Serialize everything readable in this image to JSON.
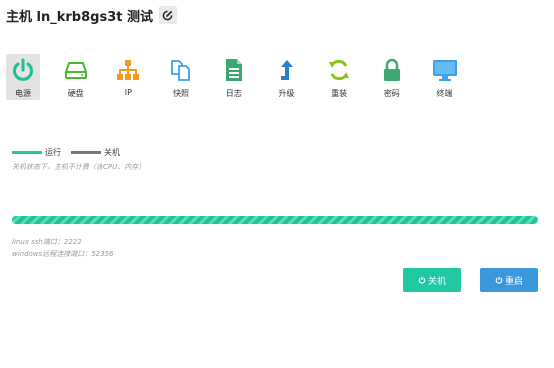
{
  "header": {
    "title": "主机  ln_krb8gs3t  测试",
    "edit_icon": "edit-icon"
  },
  "toolbar": {
    "items": [
      {
        "label": "电源",
        "icon": "power-icon",
        "active": true
      },
      {
        "label": "硬盘",
        "icon": "hard-disk-icon"
      },
      {
        "label": "IP",
        "icon": "network-icon"
      },
      {
        "label": "快照",
        "icon": "snapshot-icon"
      },
      {
        "label": "日志",
        "icon": "log-icon"
      },
      {
        "label": "升级",
        "icon": "upgrade-icon"
      },
      {
        "label": "重装",
        "icon": "reinstall-icon"
      },
      {
        "label": "密码",
        "icon": "lock-icon"
      },
      {
        "label": "终端",
        "icon": "terminal-icon"
      }
    ]
  },
  "legend": {
    "running": "运行",
    "shutdown": "关机",
    "running_color": "#22c79a",
    "shutdown_color": "#777777"
  },
  "note": "关机状态下，主机不计费（含CPU、内存）",
  "progress": {
    "fraction": 1.0
  },
  "ports": {
    "linux": "linux ssh端口：2222",
    "windows": "windows远程连接端口：52356"
  },
  "buttons": {
    "shutdown": "关机",
    "restart": "重启",
    "shutdown_color": "#1fc8a0",
    "restart_color": "#3a98db"
  }
}
